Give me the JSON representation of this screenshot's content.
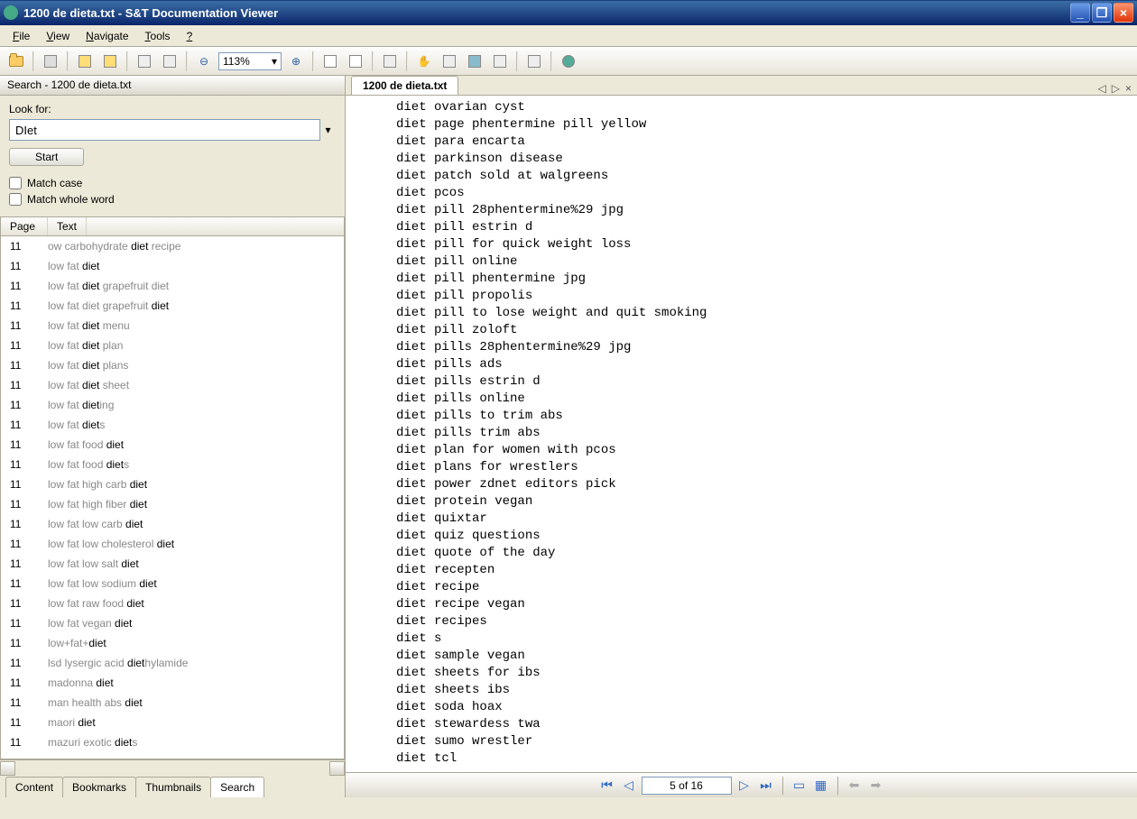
{
  "window": {
    "title": "1200 de dieta.txt - S&T Documentation Viewer"
  },
  "menu": {
    "file": "File",
    "view": "View",
    "navigate": "Navigate",
    "tools": "Tools",
    "help": "?"
  },
  "toolbar": {
    "zoom": "113%"
  },
  "sidebar": {
    "title": "Search - 1200 de dieta.txt",
    "look_for_label": "Look for:",
    "search_value": "DIet",
    "start_label": "Start",
    "match_case_label": "Match case",
    "match_whole_word_label": "Match whole word",
    "col_page": "Page",
    "col_text": "Text",
    "results": [
      {
        "page": "11",
        "pre": "ow carbohydrate ",
        "match": "diet",
        "post": " recipe"
      },
      {
        "page": "11",
        "pre": "low fat ",
        "match": "diet",
        "post": ""
      },
      {
        "page": "11",
        "pre": "low fat ",
        "match": "diet",
        "post": " grapefruit diet"
      },
      {
        "page": "11",
        "pre": "low fat diet grapefruit ",
        "match": "diet",
        "post": ""
      },
      {
        "page": "11",
        "pre": "low fat ",
        "match": "diet",
        "post": " menu"
      },
      {
        "page": "11",
        "pre": "low fat ",
        "match": "diet",
        "post": " plan"
      },
      {
        "page": "11",
        "pre": "low fat ",
        "match": "diet",
        "post": " plans"
      },
      {
        "page": "11",
        "pre": "low fat ",
        "match": "diet",
        "post": " sheet"
      },
      {
        "page": "11",
        "pre": "low fat ",
        "match": "diet",
        "post": "ing"
      },
      {
        "page": "11",
        "pre": "low fat ",
        "match": "diet",
        "post": "s"
      },
      {
        "page": "11",
        "pre": "low fat food ",
        "match": "diet",
        "post": ""
      },
      {
        "page": "11",
        "pre": "low fat food ",
        "match": "diet",
        "post": "s"
      },
      {
        "page": "11",
        "pre": "low fat high carb ",
        "match": "diet",
        "post": ""
      },
      {
        "page": "11",
        "pre": "low fat high fiber ",
        "match": "diet",
        "post": ""
      },
      {
        "page": "11",
        "pre": "low fat low carb ",
        "match": "diet",
        "post": ""
      },
      {
        "page": "11",
        "pre": "low fat low cholesterol ",
        "match": "diet",
        "post": ""
      },
      {
        "page": "11",
        "pre": "low fat low salt ",
        "match": "diet",
        "post": ""
      },
      {
        "page": "11",
        "pre": "low fat low sodium ",
        "match": "diet",
        "post": ""
      },
      {
        "page": "11",
        "pre": "low fat raw food ",
        "match": "diet",
        "post": ""
      },
      {
        "page": "11",
        "pre": "low fat vegan ",
        "match": "diet",
        "post": ""
      },
      {
        "page": "11",
        "pre": "low+fat+",
        "match": "diet",
        "post": ""
      },
      {
        "page": "11",
        "pre": "lsd lysergic acid ",
        "match": "diet",
        "post": "hylamide"
      },
      {
        "page": "11",
        "pre": "madonna ",
        "match": "diet",
        "post": ""
      },
      {
        "page": "11",
        "pre": "man health abs ",
        "match": "diet",
        "post": ""
      },
      {
        "page": "11",
        "pre": "maori ",
        "match": "diet",
        "post": ""
      },
      {
        "page": "11",
        "pre": "mazuri exotic ",
        "match": "diet",
        "post": "s"
      }
    ]
  },
  "tabs": {
    "content": "Content",
    "bookmarks": "Bookmarks",
    "thumbnails": "Thumbnails",
    "search": "Search"
  },
  "doc": {
    "tab_title": "1200 de dieta.txt",
    "lines": [
      "diet ovarian cyst",
      "diet page phentermine pill yellow",
      "diet para encarta",
      "diet parkinson disease",
      "diet patch sold at walgreens",
      "diet pcos",
      "diet pill 28phentermine%29 jpg",
      "diet pill estrin d",
      "diet pill for quick weight loss",
      "diet pill online",
      "diet pill phentermine jpg",
      "diet pill propolis",
      "diet pill to lose weight and quit smoking",
      "diet pill zoloft",
      "diet pills 28phentermine%29 jpg",
      "diet pills ads",
      "diet pills estrin d",
      "diet pills online",
      "diet pills to trim abs",
      "diet pills trim abs",
      "diet plan for women with pcos",
      "diet plans for wrestlers",
      "diet power zdnet editors pick",
      "diet protein vegan",
      "diet quixtar",
      "diet quiz questions",
      "diet quote of the day",
      "diet recepten",
      "diet recipe",
      "diet recipe vegan",
      "diet recipes",
      "diet s",
      "diet sample vegan",
      "diet sheets for ibs",
      "diet sheets ibs",
      "diet soda hoax",
      "diet stewardess twa",
      "diet sumo wrestler",
      "diet tcl"
    ]
  },
  "pagebar": {
    "label": "5 of 16"
  }
}
